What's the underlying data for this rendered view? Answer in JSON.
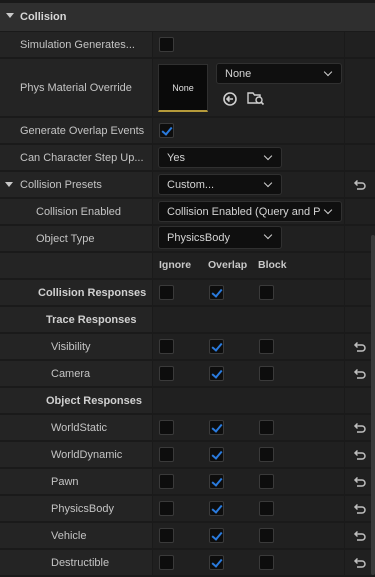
{
  "section": {
    "title": "Collision"
  },
  "rows": {
    "simulation": {
      "label": "Simulation Generates..."
    },
    "phys_material": {
      "label": "Phys Material Override",
      "thumb_text": "None",
      "value": "None"
    },
    "overlap_events": {
      "label": "Generate Overlap Events"
    },
    "step_up": {
      "label": "Can Character Step Up...",
      "value": "Yes"
    },
    "presets": {
      "label": "Collision Presets",
      "value": "Custom..."
    },
    "collision_enabled": {
      "label": "Collision Enabled",
      "value": "Collision Enabled (Query and P"
    },
    "object_type": {
      "label": "Object Type",
      "value": "PhysicsBody"
    }
  },
  "columns": {
    "ignore": "Ignore",
    "overlap": "Overlap",
    "block": "Block"
  },
  "collision_responses": {
    "label": "Collision Responses"
  },
  "trace_responses": {
    "label": "Trace Responses",
    "items": [
      {
        "label": "Visibility"
      },
      {
        "label": "Camera"
      }
    ]
  },
  "object_responses": {
    "label": "Object Responses",
    "items": [
      {
        "label": "WorldStatic"
      },
      {
        "label": "WorldDynamic"
      },
      {
        "label": "Pawn"
      },
      {
        "label": "PhysicsBody"
      },
      {
        "label": "Vehicle"
      },
      {
        "label": "Destructible"
      }
    ]
  },
  "checkbox_states": {
    "simulation": false,
    "overlap_events": true,
    "collision_responses": [
      "ignore-off",
      "overlap-on",
      "block-off"
    ],
    "response_default": "overlap"
  },
  "colors": {
    "accent": "#2a7bde",
    "thumb_underline": "#b59a3a"
  }
}
